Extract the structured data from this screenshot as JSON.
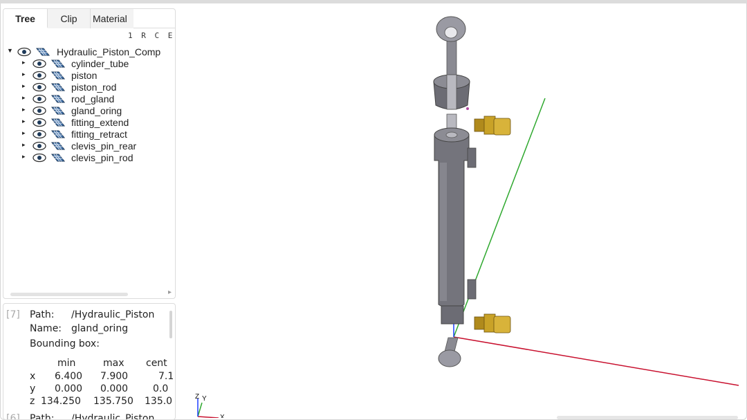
{
  "tabs": [
    {
      "label": "Tree",
      "active": true
    },
    {
      "label": "Clip",
      "active": false
    },
    {
      "label": "Material",
      "active": false
    }
  ],
  "column_headers": "1 R C E",
  "tree": {
    "root": {
      "label": "Hydraulic_Piston_Comp",
      "icons": [
        "eye-icon",
        "mesh-icon"
      ]
    },
    "children": [
      {
        "label": "cylinder_tube"
      },
      {
        "label": "piston"
      },
      {
        "label": "piston_rod"
      },
      {
        "label": "rod_gland"
      },
      {
        "label": "gland_oring"
      },
      {
        "label": "fitting_extend"
      },
      {
        "label": "fitting_retract"
      },
      {
        "label": "clevis_pin_rear"
      },
      {
        "label": "clevis_pin_rod"
      }
    ]
  },
  "info": {
    "index": "[7]",
    "path_label": "Path:",
    "path_value": "/Hydraulic_Piston",
    "name_label": "Name:",
    "name_value": "gland_oring",
    "bbox_label": "Bounding box:",
    "headers": [
      "min",
      "max",
      "cent"
    ],
    "rows": [
      {
        "axis": "x",
        "min": "6.400",
        "max": "7.900",
        "cent": "7.1"
      },
      {
        "axis": "y",
        "min": "0.000",
        "max": "0.000",
        "cent": "0.0"
      },
      {
        "axis": "z",
        "min": "134.250",
        "max": "135.750",
        "cent": "135.0"
      }
    ],
    "next_index": "[6]",
    "next_path_label": "Path:",
    "next_path_value": "/Hydraulic_Piston"
  },
  "axes_triad": {
    "x": "X",
    "y": "Y",
    "z": "Z"
  },
  "colors": {
    "x_axis": "#c8102e",
    "y_axis": "#2ea82e",
    "z_axis": "#1a3cff",
    "part_gray": "#777780",
    "brass": "#c9a227",
    "mesh_icon": "#3d6ea8"
  }
}
